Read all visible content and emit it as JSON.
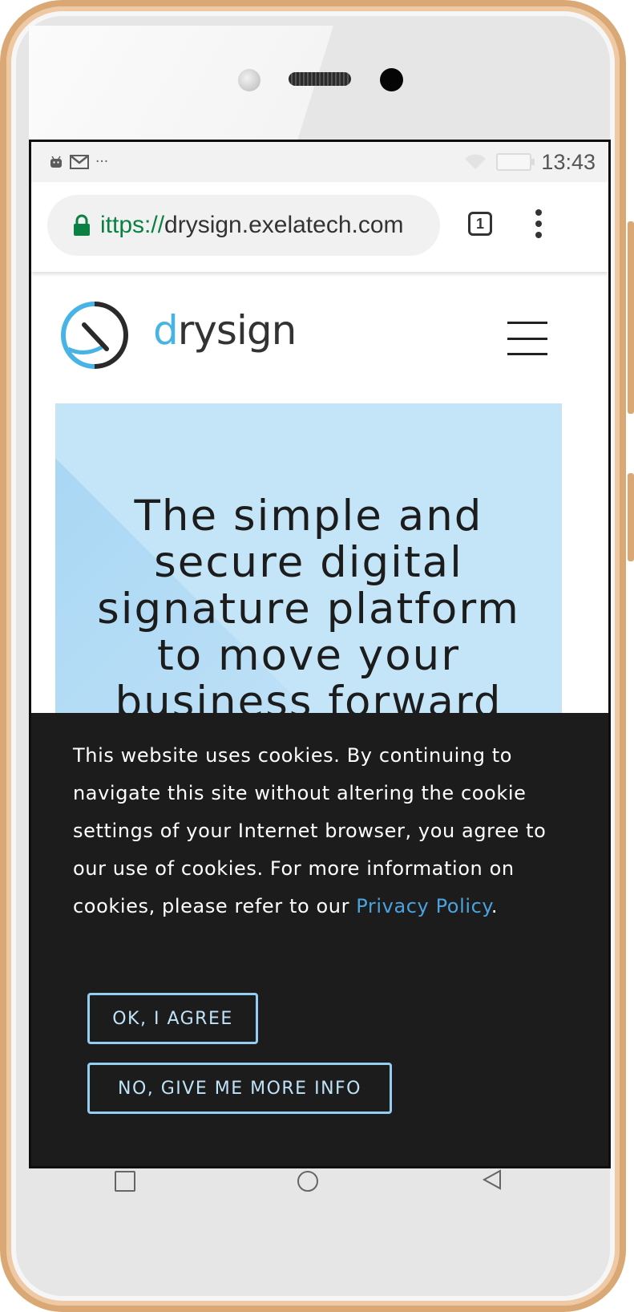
{
  "status_bar": {
    "time": "13:43",
    "overflow": "···",
    "notification_icons": [
      "android-icon",
      "gmail-icon"
    ]
  },
  "browser": {
    "url_scheme": "ittps://",
    "url_host": "drysign.exelatech.com",
    "tab_count": "1"
  },
  "site": {
    "logo_d": "d",
    "logo_rest": "rysign",
    "hero_title": "The simple and secure digital signature platform to move your business forward"
  },
  "cookie_banner": {
    "text": "This website uses cookies. By continuing to navigate this site without altering the cookie settings of your Internet browser, you agree to our use of cookies. For more information on cookies, please refer to our ",
    "link": "Privacy Policy",
    "after_link": ".",
    "agree_label": "OK, I AGREE",
    "info_label": "NO, GIVE ME MORE INFO"
  },
  "colors": {
    "accent_blue": "#48b4e6",
    "hero_bg": "#c4e5f8",
    "banner_bg": "#1c1c1c",
    "button_border": "#93cdf2",
    "secure_green": "#0b8043",
    "frame_gold": "#d9a874"
  }
}
